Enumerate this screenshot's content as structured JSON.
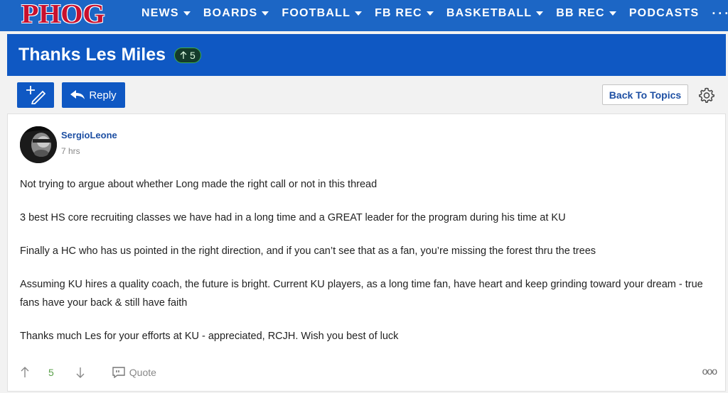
{
  "site": {
    "logo": "PHOG"
  },
  "nav": {
    "items": [
      {
        "label": "NEWS"
      },
      {
        "label": "BOARDS"
      },
      {
        "label": "FOOTBALL"
      },
      {
        "label": "FB REC"
      },
      {
        "label": "BASKETBALL"
      },
      {
        "label": "BB REC"
      },
      {
        "label": "PODCASTS"
      }
    ],
    "more": "···"
  },
  "thread": {
    "title": "Thanks Les Miles",
    "votes": "5"
  },
  "toolbar": {
    "reply_label": "Reply",
    "back_label": "Back To Topics"
  },
  "post": {
    "author": "SergioLeone",
    "time": "7 hrs",
    "paragraphs": [
      "Not trying to argue about whether Long made the right call or not in this thread",
      "3 best HS core recruiting classes we have had in a long time and a GREAT leader for the program during his time at KU",
      "Finally a HC who has us pointed in the right direction, and if you can’t see that as a fan, you’re missing the forest thru the trees",
      "Assuming KU hires a quality coach, the future is bright. Current KU players, as a long time fan, have heart and keep grinding toward your dream - true fans have your back & still have faith",
      "Thanks much Les for your efforts at KU - appreciated, RCJH. Wish you best of luck"
    ],
    "vote_count": "5",
    "quote_label": "Quote"
  },
  "colors": {
    "nav_bg": "#1c66c5",
    "title_bg": "#0f58c3",
    "accent": "#1d4fa3",
    "vote_green": "#5aa04a"
  }
}
